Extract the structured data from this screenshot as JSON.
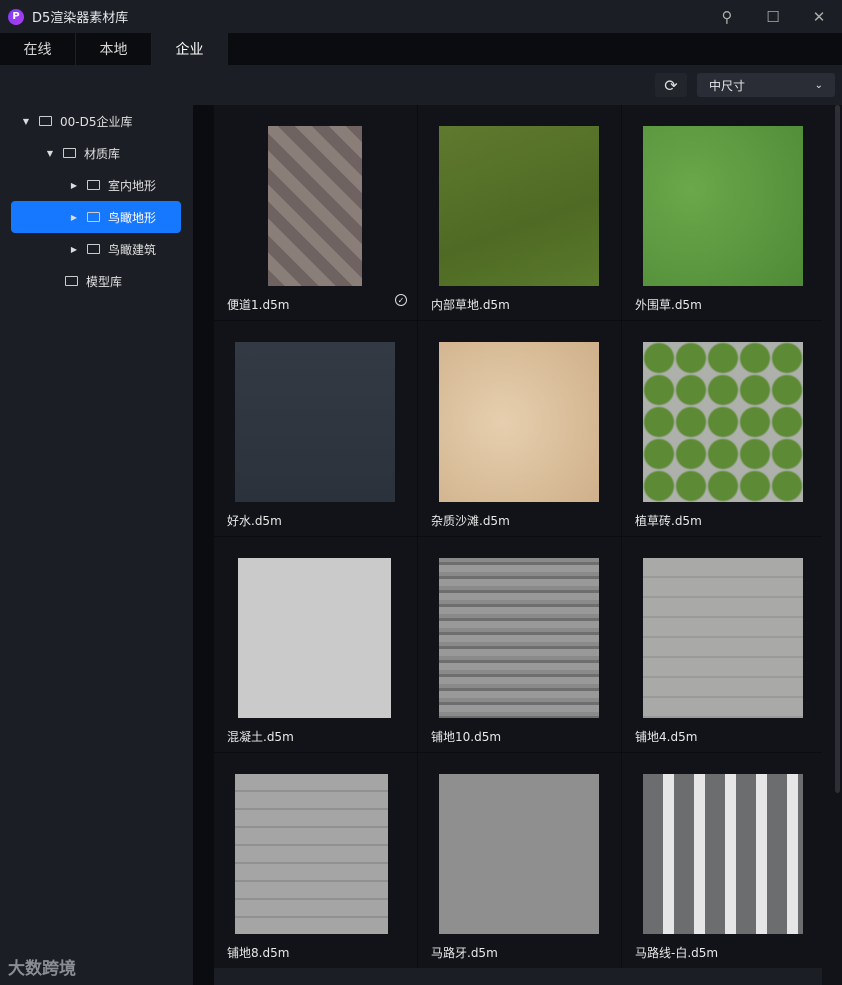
{
  "window": {
    "title": "D5渲染器素材库",
    "logo_letter": "P",
    "pin": "pin-icon",
    "maximize": "maximize-icon",
    "close": "close-icon"
  },
  "tabs": [
    {
      "label": "在线"
    },
    {
      "label": "本地"
    },
    {
      "label": "企业",
      "active": true
    }
  ],
  "toolbar": {
    "refresh": "refresh-icon",
    "size_select": "中尺寸"
  },
  "tree": [
    {
      "label": "00-D5企业库",
      "level": 0,
      "expanded": true
    },
    {
      "label": "材质库",
      "level": 1,
      "expanded": true
    },
    {
      "label": "室内地形",
      "level": 2
    },
    {
      "label": "鸟瞰地形",
      "level": 2,
      "selected": true
    },
    {
      "label": "鸟瞰建筑",
      "level": 2
    },
    {
      "label": "模型库",
      "level": 1
    }
  ],
  "watermark": "大数跨境",
  "accent": "#1677ff",
  "materials": [
    {
      "name": "便道1.d5m",
      "checked": true
    },
    {
      "name": "内部草地.d5m"
    },
    {
      "name": "外围草.d5m"
    },
    {
      "name": "好水.d5m"
    },
    {
      "name": "杂质沙滩.d5m"
    },
    {
      "name": "植草砖.d5m"
    },
    {
      "name": "混凝土.d5m"
    },
    {
      "name": "铺地10.d5m"
    },
    {
      "name": "铺地4.d5m"
    },
    {
      "name": "铺地8.d5m"
    },
    {
      "name": "马路牙.d5m"
    },
    {
      "name": "马路线-白.d5m"
    }
  ]
}
